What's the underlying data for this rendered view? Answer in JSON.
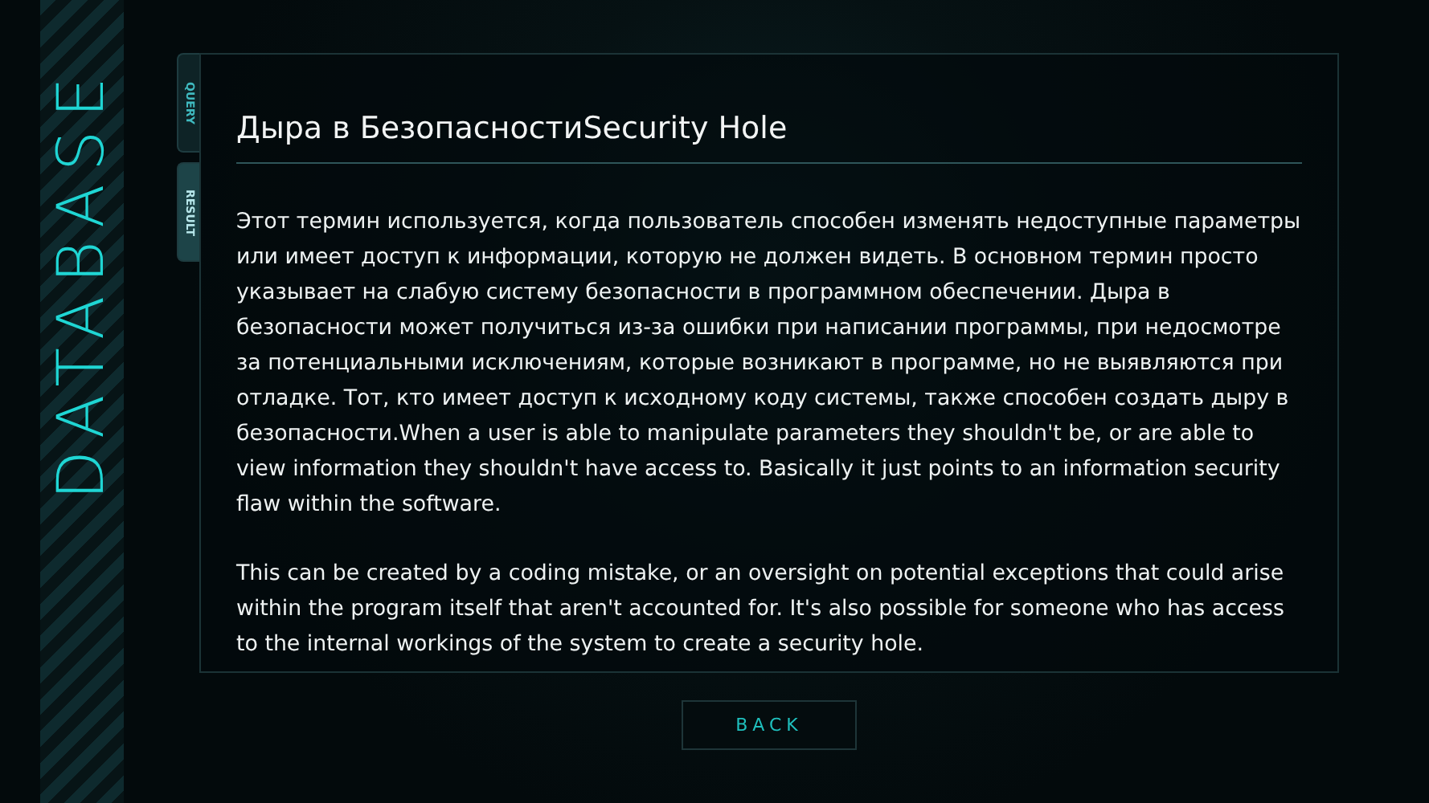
{
  "sidebar": {
    "title": "DATABASE"
  },
  "tabs": [
    {
      "label": "QUERY",
      "selected": false
    },
    {
      "label": "RESULT",
      "selected": true
    }
  ],
  "entry": {
    "title": "Дыра в БезопасностиSecurity Hole",
    "paragraphs": [
      "Этот термин используется, когда пользователь способен изменять недоступные параметры или имеет доступ к информации, которую не должен видеть. В основном термин просто указывает на слабую систему безопасности в программном обеспечении. Дыра в безопасности может получиться из-за ошибки при написании программы, при недосмотре за потенциальными исключениям, которые возникают в программе, но не выявляются при отладке. Тот, кто имеет доступ к исходному коду системы, также способен создать дыру в безопасности.When a user is able to manipulate parameters they shouldn't be, or are able to view information they shouldn't have access to. Basically it just points to an information security flaw within the software.",
      "This can be created by a coding mistake, or an oversight on potential exceptions that could arise within the program itself that aren't accounted for. It's also possible for someone who has access to the internal workings of the system to create a security hole."
    ]
  },
  "back_button": {
    "label": "BACK"
  }
}
